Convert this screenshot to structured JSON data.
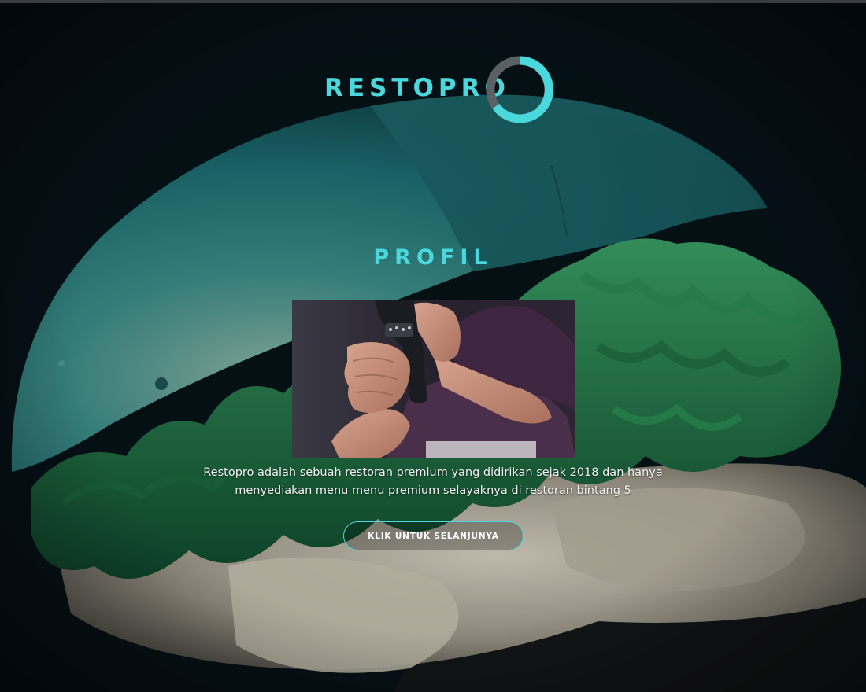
{
  "brand": {
    "logo_text": "RESTOPRO",
    "accent_color": "#4ad8dc"
  },
  "hero": {
    "background_image": "burger-image"
  },
  "profile": {
    "title": "PROFIL",
    "photo": "person-holding-grinder-image",
    "description": "Restopro adalah sebuah restoran premium yang didirikan sejak 2018 dan hanya menyediakan menu menu premium selayaknya di restoran bintang 5",
    "button_label": "KLIK UNTUK SELANJUNYA"
  }
}
